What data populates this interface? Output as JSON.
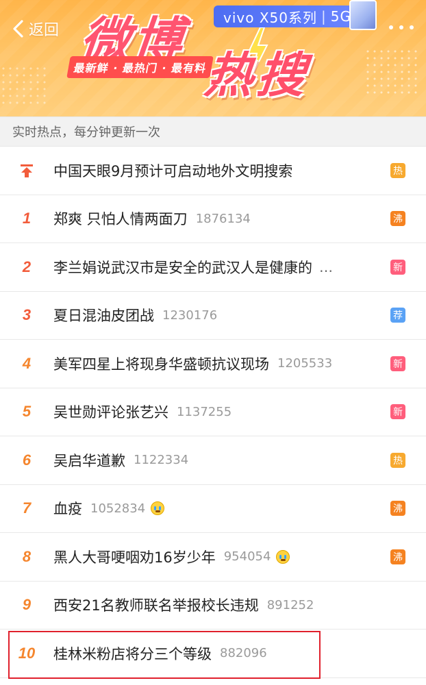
{
  "header": {
    "back_label": "返回",
    "logo_text_1": "微博",
    "logo_text_2": "热搜",
    "slogan": "最新鲜 · 最热门 · 最有料",
    "ad": {
      "brand": "vivo X50系列",
      "tag": "5G"
    }
  },
  "subheader": {
    "text": "实时热点，每分钟更新一次"
  },
  "badge_colors": {
    "热": "#f7a92f",
    "沸": "#f58220",
    "新": "#ff5e7c",
    "荐": "#5aa2f5"
  },
  "hot_list": [
    {
      "rank": "",
      "pinned": true,
      "title": "中国天眼9月预计可启动地外文明搜索",
      "count": "",
      "emoji": false,
      "badge": "热"
    },
    {
      "rank": "1",
      "title": "郑爽 只怕人情两面刀",
      "count": "1876134",
      "emoji": false,
      "badge": "沸"
    },
    {
      "rank": "2",
      "title": "李兰娟说武汉市是安全的武汉人是健康的",
      "count": "",
      "truncated": true,
      "emoji": false,
      "badge": "新"
    },
    {
      "rank": "3",
      "title": "夏日混油皮团战",
      "count": "1230176",
      "emoji": false,
      "badge": "荐"
    },
    {
      "rank": "4",
      "title": "美军四星上将现身华盛顿抗议现场",
      "count": "1205533",
      "emoji": false,
      "badge": "新"
    },
    {
      "rank": "5",
      "title": "吴世勋评论张艺兴",
      "count": "1137255",
      "emoji": false,
      "badge": "新"
    },
    {
      "rank": "6",
      "title": "吴启华道歉",
      "count": "1122334",
      "emoji": false,
      "badge": "热"
    },
    {
      "rank": "7",
      "title": "血疫",
      "count": "1052834",
      "emoji": true,
      "badge": "沸"
    },
    {
      "rank": "8",
      "title": "黑人大哥哽咽劝16岁少年",
      "count": "954054",
      "emoji": true,
      "badge": "沸"
    },
    {
      "rank": "9",
      "title": "西安21名教师联名举报校长违规",
      "count": "891252",
      "emoji": false,
      "badge": ""
    },
    {
      "rank": "10",
      "title": "桂林米粉店将分三个等级",
      "count": "882096",
      "emoji": false,
      "badge": "",
      "highlighted": true
    }
  ]
}
